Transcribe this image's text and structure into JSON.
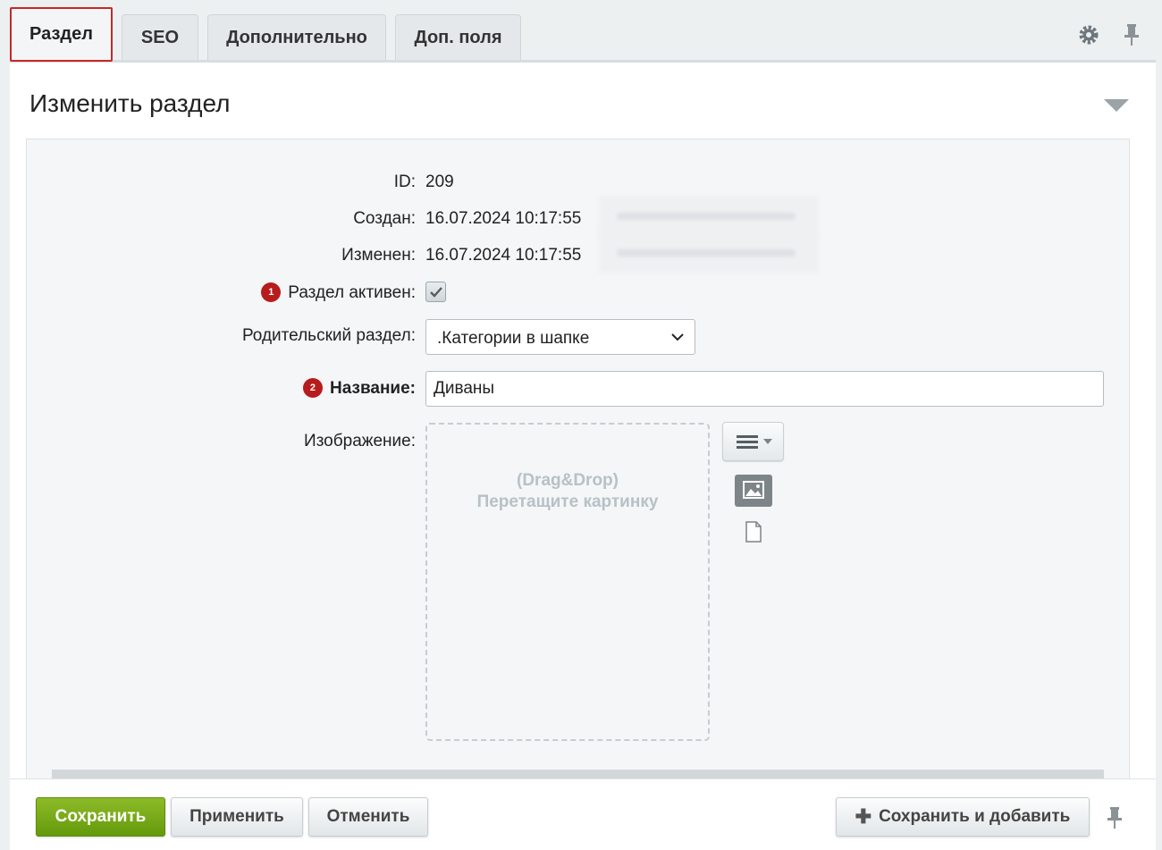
{
  "tabs": [
    {
      "label": "Раздел",
      "active": true
    },
    {
      "label": "SEO",
      "active": false
    },
    {
      "label": "Дополнительно",
      "active": false
    },
    {
      "label": "Доп. поля",
      "active": false
    }
  ],
  "header": {
    "title": "Изменить раздел",
    "settings_icon": "gear-icon",
    "pin_icon": "pin-icon",
    "collapse_icon": "triangle-down-icon"
  },
  "form": {
    "id": {
      "label": "ID:",
      "value": "209"
    },
    "created": {
      "label": "Создан:",
      "value": "16.07.2024 10:17:55"
    },
    "modified": {
      "label": "Изменен:",
      "value": "16.07.2024 10:17:55"
    },
    "active": {
      "badge": "1",
      "label": "Раздел активен:",
      "checked": true
    },
    "parent": {
      "label": "Родительский раздел:",
      "value": ".Категории в шапке"
    },
    "name": {
      "badge": "2",
      "label": "Название:",
      "value": "Диваны"
    },
    "image": {
      "label": "Изображение:",
      "dropzone_line1": "(Drag&Drop)",
      "dropzone_line2": "Перетащите картинку",
      "menu_icon": "hamburger-menu-icon",
      "image_icon": "image-icon",
      "file_icon": "file-icon"
    }
  },
  "footer": {
    "save": "Сохранить",
    "apply": "Применить",
    "cancel": "Отменить",
    "save_add": "Сохранить и добавить",
    "save_add_icon": "plus-icon"
  },
  "colors": {
    "active_tab_border": "#c62828",
    "badge": "#b71c1c",
    "save_button": "#7aab1a"
  }
}
